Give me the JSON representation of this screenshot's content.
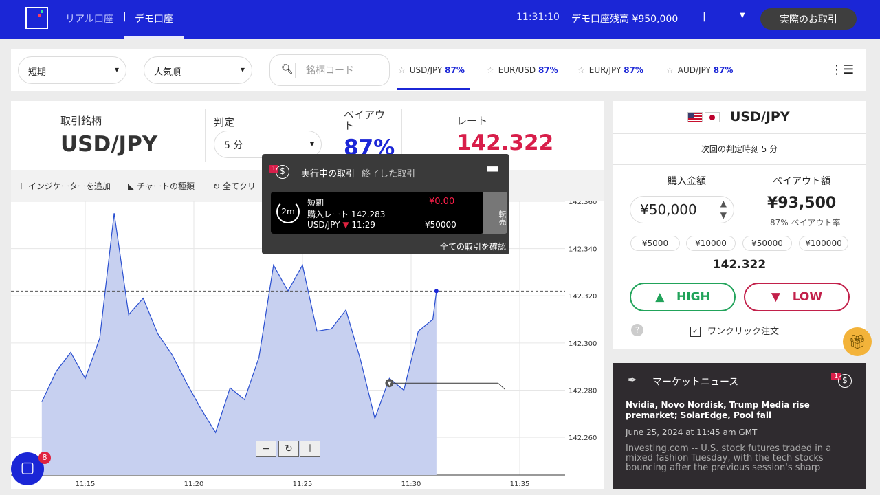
{
  "header": {
    "account_real": "リアル口座",
    "account_separator": "|",
    "account_demo": "デモ口座",
    "time": "11:31:10",
    "balance_label": "デモ口座残高 ¥950,000",
    "separator": "|",
    "real_trade_button": "実際のお取引"
  },
  "filters": {
    "term": "短期",
    "sort": "人気順",
    "search_placeholder": "銘柄コード",
    "pairs": [
      {
        "name": "USD/JPY",
        "payout": "87%"
      },
      {
        "name": "EUR/USD",
        "payout": "87%"
      },
      {
        "name": "EUR/JPY",
        "payout": "87%"
      },
      {
        "name": "AUD/JPY",
        "payout": "87%"
      }
    ]
  },
  "instrument": {
    "symbol_label": "取引銘柄",
    "symbol": "USD/JPY",
    "expiry_label": "判定",
    "expiry": "5 分",
    "payout_label": "ペイアウト",
    "payout": "87%",
    "rate_label": "レート",
    "rate": "142.322"
  },
  "toolbar": {
    "add_indicator": "インジケーターを追加",
    "chart_type": "チャートの種類",
    "clear_all": "全てクリ"
  },
  "open_trades": {
    "badge": "1",
    "tab_active": "実行中の取引",
    "tab_closed": "終了した取引",
    "timer": "2m",
    "term": "短期",
    "entry_rate": "購入レート 142.283",
    "pnl": "¥0.00",
    "pair": "USD/JPY",
    "time": "11:29",
    "amount": "¥50000",
    "resell": "転売",
    "view_all": "全ての取引を確認"
  },
  "trade_panel": {
    "pair": "USD/JPY",
    "next_expiry": "次回の判定時刻 5 分",
    "amount_label": "購入金額",
    "amount": "¥50,000",
    "payout_label": "ペイアウト額",
    "payout_amount": "¥93,500",
    "payout_rate": "87% ペイアウト率",
    "quick_amounts": [
      "¥5000",
      "¥10000",
      "¥50000",
      "¥100000"
    ],
    "current_rate": "142.322",
    "high_label": "HIGH",
    "low_label": "LOW",
    "help": "?",
    "one_click": "ワンクリック注文"
  },
  "news": {
    "title": "マーケットニュース",
    "badge": "1",
    "headline": "Nvidia, Novo Nordisk, Trump Media rise premarket; SolarEdge, Pool fall",
    "date": "June 25, 2024 at 11:45 am GMT",
    "body": "Investing.com -- U.S. stock futures traded in a mixed fashion Tuesday, with the tech stocks bouncing after the previous session's sharp"
  },
  "chat": {
    "badge": "8"
  },
  "colors": {
    "brand": "#1b26d6",
    "high": "#21a35a",
    "low": "#c2204a",
    "rate": "#d81e4a"
  },
  "chart_data": {
    "type": "area",
    "x_ticks": [
      "11:15",
      "11:20",
      "11:25",
      "11:30",
      "11:35"
    ],
    "y_ticks": [
      "142.360",
      "142.340",
      "142.320",
      "142.300",
      "142.280",
      "142.260"
    ],
    "ylim": [
      142.244,
      142.36
    ],
    "current_rate": 142.322,
    "entry_rate": 142.283,
    "x": [
      "11:13:00",
      "11:13:40",
      "11:14:20",
      "11:15:00",
      "11:15:40",
      "11:16:20",
      "11:17:00",
      "11:17:40",
      "11:18:20",
      "11:19:00",
      "11:19:40",
      "11:20:20",
      "11:21:00",
      "11:21:40",
      "11:22:20",
      "11:23:00",
      "11:23:40",
      "11:24:20",
      "11:25:00",
      "11:25:40",
      "11:26:20",
      "11:27:00",
      "11:27:40",
      "11:28:20",
      "11:29:00",
      "11:29:40",
      "11:30:20",
      "11:31:00",
      "11:31:10"
    ],
    "values": [
      142.275,
      142.288,
      142.296,
      142.285,
      142.302,
      142.355,
      142.312,
      142.319,
      142.304,
      142.295,
      142.283,
      142.272,
      142.262,
      142.281,
      142.276,
      142.294,
      142.333,
      142.322,
      142.333,
      142.305,
      142.306,
      142.314,
      142.293,
      142.268,
      142.285,
      142.28,
      142.305,
      142.31,
      142.322
    ]
  }
}
